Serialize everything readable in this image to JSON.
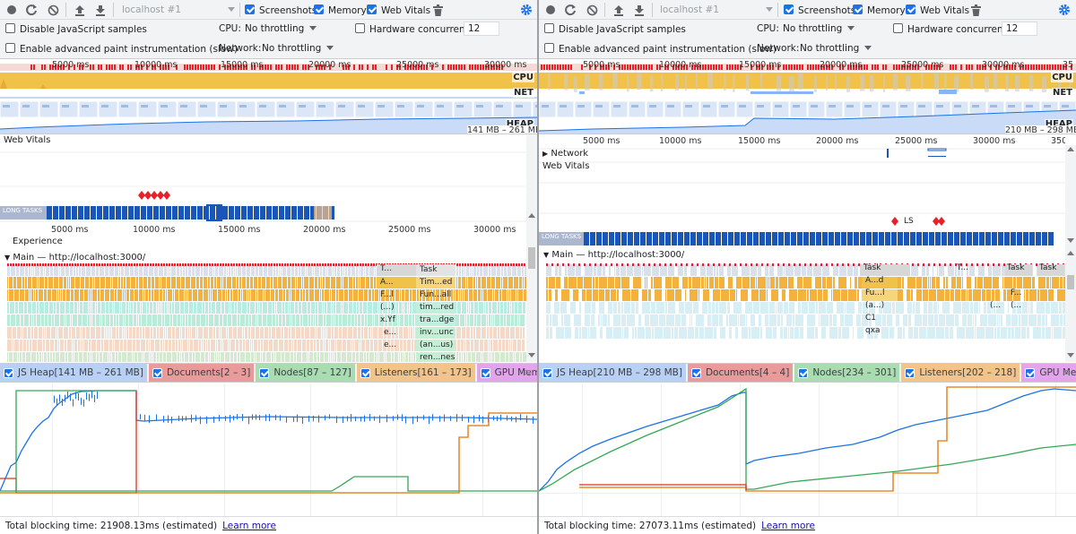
{
  "panels": [
    {
      "id": "left",
      "toolbar": {
        "url": "localhost #1",
        "screenshots_label": "Screenshots",
        "memory_label": "Memory",
        "webvitals_label": "Web Vitals"
      },
      "settings": {
        "disable_js_label": "Disable JavaScript samples",
        "cpu_label": "CPU:",
        "cpu_value": "No throttling",
        "hw_label": "Hardware concurrency",
        "hw_value": "12",
        "paint_label": "Enable advanced paint instrumentation (slow)",
        "network_label": "Network:",
        "network_value": "No throttling"
      },
      "overview": {
        "ticks": [
          "5000 ms",
          "10000 ms",
          "15000 ms",
          "20000 ms",
          "25000 ms",
          "30000 ms"
        ],
        "cpu_label": "CPU",
        "net_label": "NET",
        "heap_label": "HEAP",
        "heap_range": "141 MB – 261 MB"
      },
      "webvitals_label": "Web Vitals",
      "long_tasks_label": "LONG TASKS",
      "ruler_ticks": [
        "5000 ms",
        "10000 ms",
        "15000 ms",
        "20000 ms",
        "25000 ms",
        "30000 ms"
      ],
      "experience_label": "Experience",
      "main_label": "Main — http://localhost:3000/",
      "flame_col1": [
        "T...",
        "A...",
        "F...l",
        "(...)",
        "x.Yf",
        "e...",
        "e..."
      ],
      "flame_col2": [
        "Task",
        "Tim...ed",
        "Fun...all",
        "tim...red",
        "tra...dge",
        "inv...unc",
        "(an...us)",
        "ren...nes"
      ],
      "legend": {
        "js_heap": "JS Heap[141 MB – 261 MB]",
        "documents": "Documents[2 – 3]",
        "nodes": "Nodes[87 – 127]",
        "listeners": "Listeners[161 – 173]",
        "gpu": "GPU Memory"
      },
      "footer": {
        "text": "Total blocking time: 21908.13ms (estimated)",
        "link": "Learn more"
      }
    },
    {
      "id": "right",
      "toolbar": {
        "url": "localhost #1",
        "screenshots_label": "Screenshots",
        "memory_label": "Memory",
        "webvitals_label": "Web Vitals"
      },
      "settings": {
        "disable_js_label": "Disable JavaScript samples",
        "cpu_label": "CPU:",
        "cpu_value": "No throttling",
        "hw_label": "Hardware concurrency",
        "hw_value": "12",
        "paint_label": "Enable advanced paint instrumentation (slow)",
        "network_label": "Network:",
        "network_value": "No throttling"
      },
      "overview": {
        "ticks": [
          "5000 ms",
          "10000 ms",
          "15000 ms",
          "20000 ms",
          "25000 ms",
          "30000 ms",
          "35"
        ],
        "cpu_label": "CPU",
        "net_label": "NET",
        "heap_label": "HEAP",
        "heap_range": "210 MB – 298 MB"
      },
      "ruler_ticks": [
        "5000 ms",
        "10000 ms",
        "15000 ms",
        "20000 ms",
        "25000 ms",
        "30000 ms",
        "350"
      ],
      "network_label": "Network",
      "webvitals_label": "Web Vitals",
      "ls_label": "LS",
      "long_tasks_label": "LONG TASKS",
      "main_label": "Main — http://localhost:3000/",
      "flame_col1": [
        "Task",
        "A...d",
        "Fu...l",
        "(a...)",
        "C1",
        "qxa"
      ],
      "flame_extra": [
        "T...",
        "Task",
        "Task",
        "F...",
        "(...",
        "(..."
      ],
      "legend": {
        "js_heap": "JS Heap[210 MB – 298 MB]",
        "documents": "Documents[4 – 4]",
        "nodes": "Nodes[234 – 301]",
        "listeners": "Listeners[202 – 218]",
        "gpu": "GPU Memory"
      },
      "footer": {
        "text": "Total blocking time: 27073.11ms (estimated)",
        "link": "Learn more"
      }
    }
  ],
  "colors": {
    "js_heap": "#1a73e8",
    "documents": "#d93025",
    "nodes": "#34a853",
    "listeners": "#e37400",
    "gpu": "#c548d0",
    "cpu": "#f0c24a",
    "long_task": "#1a56b8",
    "red": "#e8202a"
  }
}
